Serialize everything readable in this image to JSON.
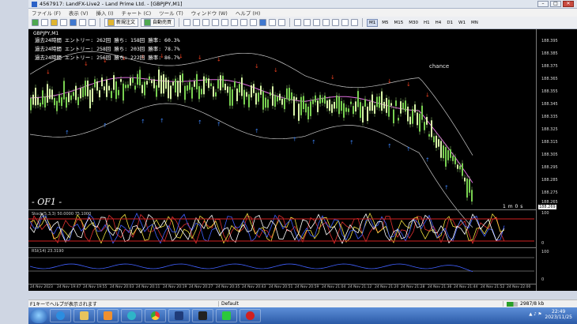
{
  "window": {
    "title": "4567917: LandFX-Live2 - Land Prime Ltd. - [GBPJPY,M1]"
  },
  "menu": [
    "ファイル (F)",
    "表示 (V)",
    "挿入 (I)",
    "チャート (C)",
    "ツール (T)",
    "ウィンドウ (W)",
    "ヘルプ (H)"
  ],
  "toolbar": {
    "new_order": "新規注文",
    "autotrading": "自動売買",
    "timeframes": [
      "M1",
      "M5",
      "M15",
      "M30",
      "H1",
      "H4",
      "D1",
      "W1",
      "MN"
    ],
    "active_tf": "M1"
  },
  "chart": {
    "symbol": "GBPJPY,M1",
    "stats": [
      "過去24時間  エントリー: 262回  勝ち: 158回  勝率: 60.3%",
      "過去24時間  エントリー: 258回  勝ち: 203回  勝率: 78.7%",
      "過去24時間  エントリー: 256回  勝ち: 222回  勝率: 86.7%"
    ],
    "watermark": "- OF1 -",
    "annotation": "chance",
    "timer": "1 m 0 s",
    "price_labels": [
      "188.395",
      "188.385",
      "188.375",
      "188.365",
      "188.355",
      "188.345",
      "188.335",
      "188.325",
      "188.315",
      "188.305",
      "188.295",
      "188.285",
      "188.275",
      "188.265"
    ],
    "current_price": "188.269",
    "stoch_label": "Stoch(5,3,3) 50.0000 75.1000",
    "stoch_axis": [
      "100",
      "0"
    ],
    "rsi_label": "RSI(14) 23.3190",
    "rsi_axis": [
      "100",
      "0"
    ],
    "time_labels": [
      "24 Nov 2023",
      "24 Nov 19:47",
      "24 Nov 19:55",
      "24 Nov 20:03",
      "24 Nov 20:11",
      "24 Nov 20:19",
      "24 Nov 20:27",
      "24 Nov 20:35",
      "24 Nov 20:43",
      "24 Nov 20:51",
      "24 Nov 20:59",
      "24 Nov 21:04",
      "24 Nov 21:12",
      "24 Nov 21:20",
      "24 Nov 21:28",
      "24 Nov 21:36",
      "24 Nov 21:44",
      "24 Nov 21:52",
      "24 Nov 22:00"
    ]
  },
  "status": {
    "help": "F1キーでヘルプが表示されます",
    "profile": "Default",
    "traffic": "2987/8 kb"
  },
  "taskbar": {
    "time": "22:49",
    "date": "2023/11/25"
  },
  "colors": {
    "chart_bg": "#000000",
    "candle_up": "#d8f5a8",
    "candle_down": "#78d050",
    "arrow_buy": "#3a7ff0",
    "arrow_sell": "#f04020",
    "ma": "#e070e0"
  }
}
